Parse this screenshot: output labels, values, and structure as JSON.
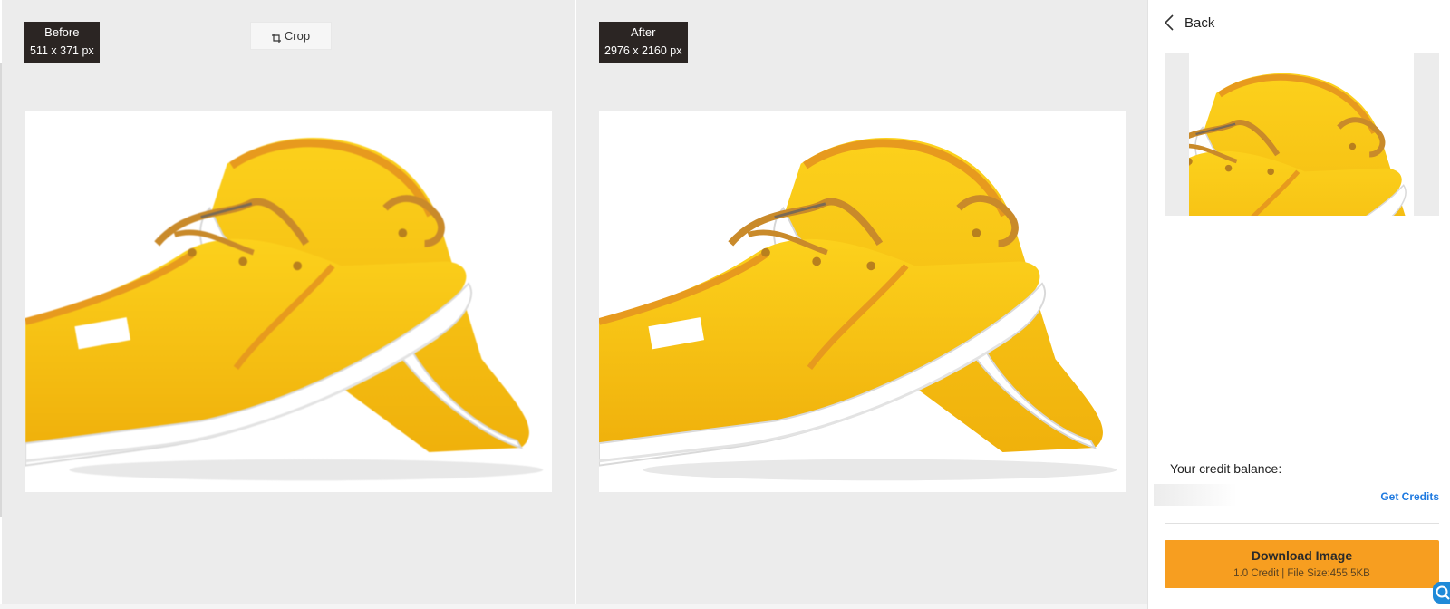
{
  "before": {
    "label": "Before",
    "dimensions": "511 x 371 px",
    "crop_label": "Crop",
    "image_alt": "Yellow canvas sneakers (original)"
  },
  "after": {
    "label": "After",
    "dimensions": "2976 x 2160 px",
    "image_alt": "Yellow canvas sneakers (upscaled)"
  },
  "sidebar": {
    "back_label": "Back",
    "credit_balance_label": "Your credit balance:",
    "get_credits_label": "Get Credits",
    "download": {
      "title": "Download Image",
      "subtitle": "1.0 Credit | File Size:455.5KB"
    }
  },
  "colors": {
    "accent": "#f79e20",
    "link": "#1f7ae0",
    "badge": "#2b2523",
    "pane": "#ececec"
  },
  "icons": {
    "crop": "crop-icon",
    "back": "chevron-left-icon",
    "help": "search-help-icon"
  }
}
